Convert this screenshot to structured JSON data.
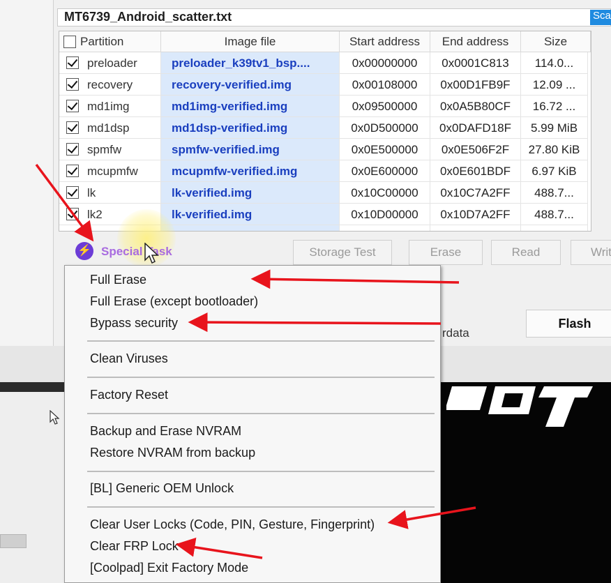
{
  "scatter": {
    "file_name": "MT6739_Android_scatter.txt",
    "button_label": "Sca"
  },
  "table": {
    "headers": {
      "partition": "Partition",
      "image": "Image file",
      "start": "Start address",
      "end": "End address",
      "size": "Size"
    },
    "rows": [
      {
        "partition": "preloader",
        "image": "preloader_k39tv1_bsp....",
        "start": "0x00000000",
        "end": "0x0001C813",
        "size": "114.0..."
      },
      {
        "partition": "recovery",
        "image": "recovery-verified.img",
        "start": "0x00108000",
        "end": "0x00D1FB9F",
        "size": "12.09 ..."
      },
      {
        "partition": "md1img",
        "image": "md1img-verified.img",
        "start": "0x09500000",
        "end": "0x0A5B80CF",
        "size": "16.72 ..."
      },
      {
        "partition": "md1dsp",
        "image": "md1dsp-verified.img",
        "start": "0x0D500000",
        "end": "0x0DAFD18F",
        "size": "5.99 MiB"
      },
      {
        "partition": "spmfw",
        "image": "spmfw-verified.img",
        "start": "0x0E500000",
        "end": "0x0E506F2F",
        "size": "27.80 KiB"
      },
      {
        "partition": "mcupmfw",
        "image": "mcupmfw-verified.img",
        "start": "0x0E600000",
        "end": "0x0E601BDF",
        "size": "6.97 KiB"
      },
      {
        "partition": "lk",
        "image": "lk-verified.img",
        "start": "0x10C00000",
        "end": "0x10C7A2FF",
        "size": "488.7..."
      },
      {
        "partition": "lk2",
        "image": "lk-verified.img",
        "start": "0x10D00000",
        "end": "0x10D7A2FF",
        "size": "488.7..."
      }
    ]
  },
  "actions": {
    "special_task": "Special Task",
    "storage_test": "Storage Test",
    "erase": "Erase",
    "read": "Read",
    "write": "Writ",
    "flash": "Flash",
    "userdata_fragment": "rdata"
  },
  "menu": {
    "items": [
      "Full Erase",
      "Full Erase (except bootloader)",
      "Bypass security",
      "Clean Viruses",
      "Factory Reset",
      "Backup and Erase NVRAM",
      "Restore NVRAM from backup",
      "[BL] Generic OEM Unlock",
      "Clear User Locks (Code, PIN, Gesture, Fingerprint)",
      "Clear FRP Lock",
      "[Coolpad] Exit Factory Mode"
    ]
  },
  "colors": {
    "image_cell_bg": "#dbe9fb",
    "image_text": "#1a3fbf",
    "special_task": "#a86be0",
    "arrow": "#e8141c",
    "scatter_button": "#1f8be0"
  },
  "icons": {
    "special_task": "lightning-bolt-icon",
    "checkbox": "checkmark-icon",
    "cursor": "mouse-pointer-icon",
    "annotation": "red-arrow-icon"
  }
}
